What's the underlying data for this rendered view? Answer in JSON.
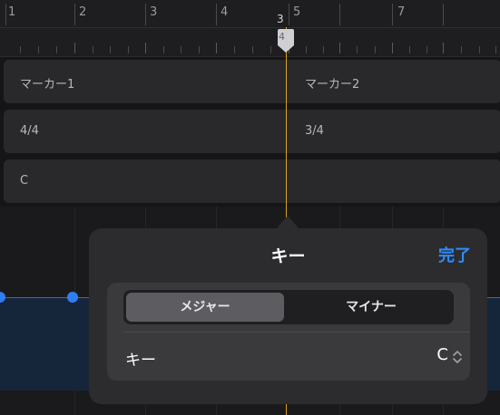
{
  "ruler": {
    "bars": [
      "1",
      "2",
      "3",
      "4",
      "5",
      "7"
    ],
    "playhead_top": "3",
    "playhead_bottom": "4"
  },
  "tracks": {
    "markers": [
      "マーカー1",
      "マーカー2"
    ],
    "signatures": [
      "4/4",
      "3/4"
    ],
    "key": "C"
  },
  "popover": {
    "title": "キー",
    "done_label": "完了",
    "segment": {
      "options": [
        "メジャー",
        "マイナー"
      ],
      "selected": "メジャー"
    },
    "key_row_label": "キー",
    "key_value": "C"
  },
  "colors": {
    "accent": "#2e8cff",
    "playhead": "#d9a21b",
    "region": "#16263a",
    "region_dot": "#2f7df0"
  }
}
